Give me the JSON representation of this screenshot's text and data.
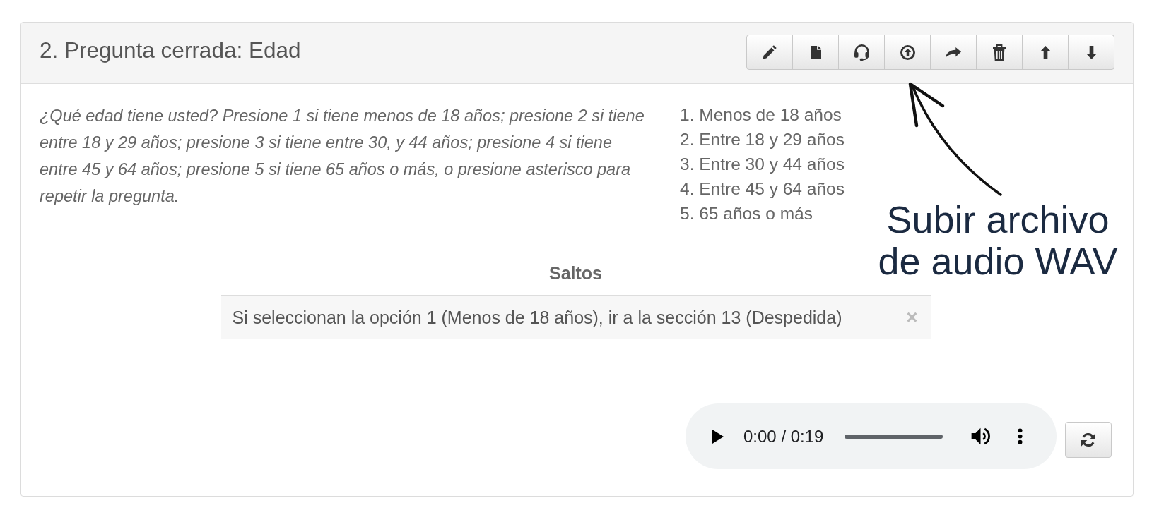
{
  "panel": {
    "title": "2. Pregunta cerrada: Edad",
    "toolbar": [
      {
        "kind": "pencil"
      },
      {
        "kind": "file"
      },
      {
        "kind": "headset"
      },
      {
        "kind": "upload"
      },
      {
        "kind": "share"
      },
      {
        "kind": "trash"
      },
      {
        "kind": "up"
      },
      {
        "kind": "down"
      }
    ]
  },
  "question": "¿Qué edad tiene usted? Presione 1 si tiene menos de 18 años; presione 2 si tiene entre 18 y 29 años; presione 3 si tiene entre 30, y 44 años; presione 4 si tiene entre 45 y 64 años; presione 5 si tiene 65 años o más, o presione asterisco para repetir la pregunta.",
  "options": [
    "1. Menos de 18 años",
    "2. Entre 18 y 29 años",
    "3. Entre 30 y 44 años",
    "4. Entre 45 y 64 años",
    "5. 65 años o más"
  ],
  "jumps": {
    "title": "Saltos",
    "rules": [
      {
        "text": "Si seleccionan la opción 1 (Menos de 18 años), ir a la sección 13 (Despedida)",
        "remove": "×"
      }
    ]
  },
  "audio": {
    "time": "0:00 / 0:19"
  },
  "annotation": {
    "text": "Subir archivo de audio WAV"
  }
}
